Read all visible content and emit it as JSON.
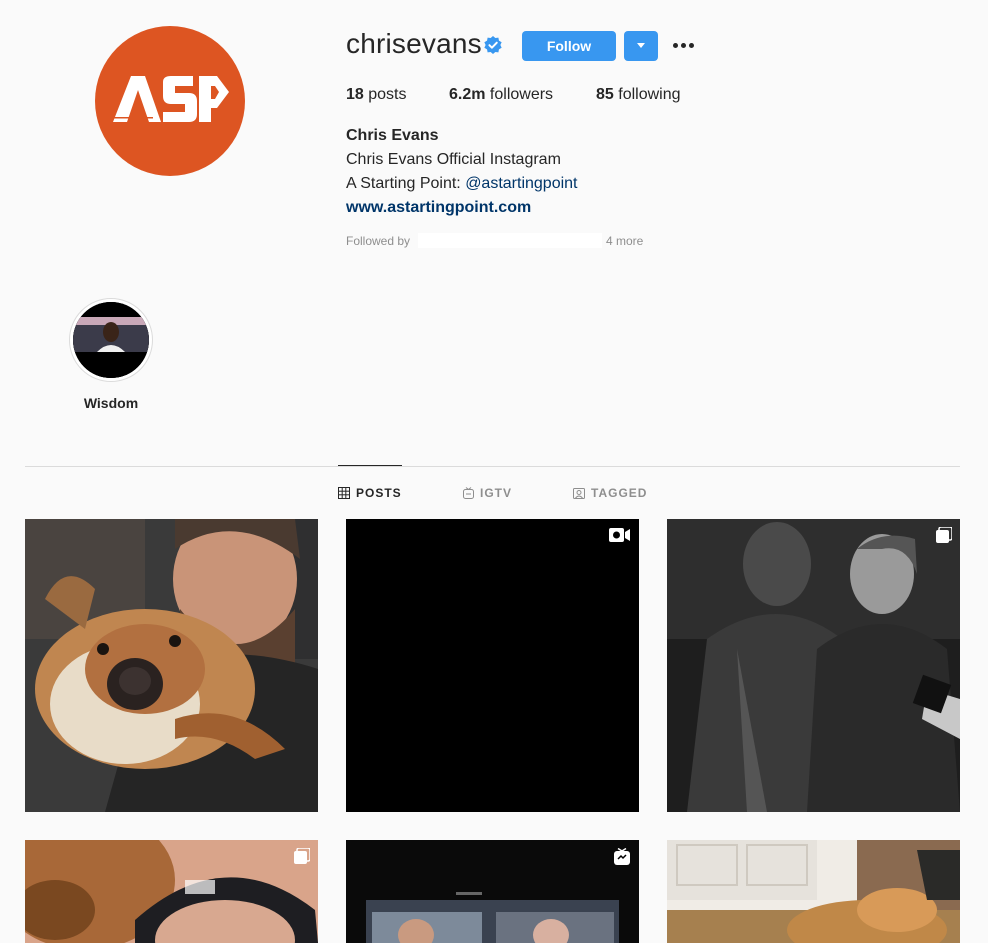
{
  "profile": {
    "username": "chrisevans",
    "verified_icon": "verified-badge-icon",
    "follow_label": "Follow",
    "dropdown_icon": "caret-down-icon",
    "more_icon": "more-options-icon",
    "avatar_text": "ASP",
    "avatar_color": "#dd5522"
  },
  "stats": {
    "posts_count": "18",
    "posts_label": "posts",
    "followers_count": "6.2m",
    "followers_label": "followers",
    "following_count": "85",
    "following_label": "following"
  },
  "bio": {
    "name": "Chris Evans",
    "line1": "Chris Evans Official Instagram",
    "line2_prefix": "A Starting Point: ",
    "line2_mention": "@astartingpoint",
    "website": "www.astartingpoint.com",
    "followed_by_label": "Followed by",
    "followed_more": "4 more"
  },
  "highlights": [
    {
      "label": "Wisdom"
    }
  ],
  "tabs": [
    {
      "label": "POSTS",
      "icon": "grid-icon",
      "active": true
    },
    {
      "label": "IGTV",
      "icon": "igtv-icon",
      "active": false
    },
    {
      "label": "TAGGED",
      "icon": "tagged-icon",
      "active": false
    }
  ],
  "posts": [
    {
      "subject": "selfie-with-dog",
      "badge": ""
    },
    {
      "subject": "black-video",
      "badge": "video-icon"
    },
    {
      "subject": "two-men-black-and-white",
      "badge": "carousel-icon"
    },
    {
      "subject": "man-in-cap-with-dog",
      "badge": "carousel-icon"
    },
    {
      "subject": "tv-interview",
      "badge": "igtv-icon"
    },
    {
      "subject": "dog-on-floor",
      "badge": ""
    }
  ],
  "colors": {
    "accent": "#3897f0",
    "link": "#003569",
    "muted": "#8e8e8e",
    "text": "#262626",
    "background": "#fafafa"
  }
}
